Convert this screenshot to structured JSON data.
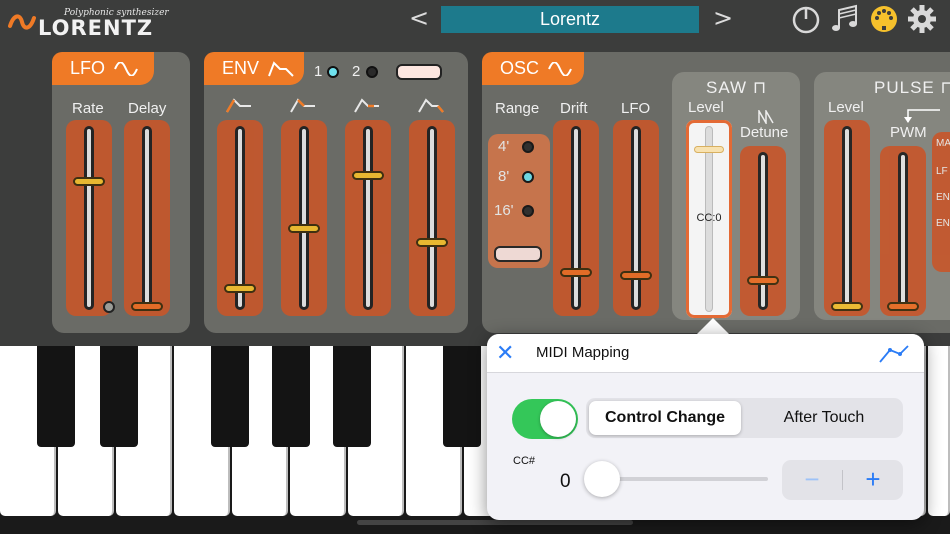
{
  "app": {
    "subtitle": "Polyphonic synthesizer",
    "name": "LORENTZ"
  },
  "nav": {
    "prev": "<",
    "next": ">",
    "preset_name": "Lorentz"
  },
  "icons": [
    "power-icon",
    "music-notes-icon",
    "midi-icon",
    "gear-icon"
  ],
  "lfo": {
    "title": "LFO",
    "labels": [
      "Rate",
      "Delay"
    ]
  },
  "env": {
    "title": "ENV",
    "select_1": "1",
    "select_2": "2",
    "selected": "1"
  },
  "osc": {
    "title": "OSC",
    "range_label": "Range",
    "range_options": [
      "4'",
      "8'",
      "16'"
    ],
    "range_selected": "8'",
    "drift_label": "Drift",
    "lfo_label": "LFO",
    "saw_title": "SAW",
    "saw_level": "Level",
    "saw_detune": "Detune",
    "cc_tag": "CC:0",
    "pulse_title": "PULSE",
    "pulse_level": "Level",
    "pulse_pwm": "PWM",
    "mod_sources_clipped": [
      "MA",
      "LF",
      "EN",
      "EN"
    ]
  },
  "midi": {
    "title": "MIDI Mapping",
    "enabled": true,
    "mode_options": [
      "Control Change",
      "After Touch"
    ],
    "mode_selected": "Control Change",
    "cc_label": "CC#",
    "cc_value": "0",
    "minus": "−",
    "plus": "+"
  },
  "colors": {
    "accent": "#ef7a26",
    "preset_bg": "#1d7a8c",
    "ios_blue": "#2b7cf6",
    "toggle_on": "#34c759"
  }
}
